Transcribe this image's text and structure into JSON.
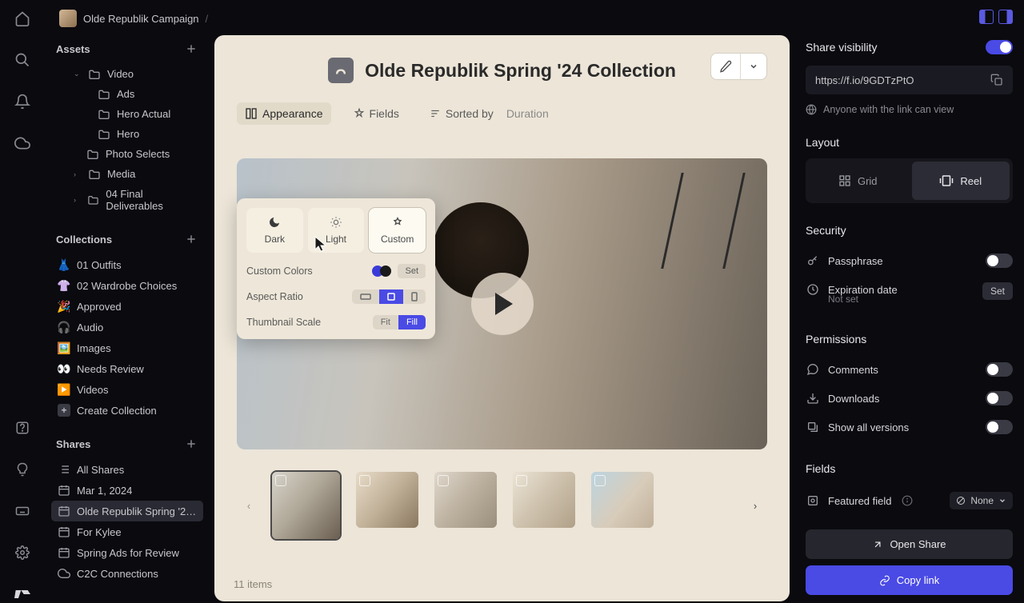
{
  "breadcrumb": {
    "project": "Olde Republik Campaign",
    "page": "Olde Republik Spring '24 …"
  },
  "assets": {
    "label": "Assets",
    "tree": [
      {
        "label": "Video",
        "indent": 1,
        "chev": true,
        "open": true
      },
      {
        "label": "Ads",
        "indent": 3
      },
      {
        "label": "Hero Actual",
        "indent": 3
      },
      {
        "label": "Hero",
        "indent": 3
      },
      {
        "label": "Photo Selects",
        "indent": 2
      },
      {
        "label": "Media",
        "indent": 1,
        "chev": true
      },
      {
        "label": "04 Final Deliverables",
        "indent": 1,
        "chev": true
      }
    ]
  },
  "collections": {
    "label": "Collections",
    "items": [
      {
        "icon": "👗",
        "label": "01 Outfits"
      },
      {
        "icon": "👚",
        "label": "02 Wardrobe Choices"
      },
      {
        "icon": "🎉",
        "label": "Approved"
      },
      {
        "icon": "🎧",
        "label": "Audio"
      },
      {
        "icon": "🖼️",
        "label": "Images"
      },
      {
        "icon": "👀",
        "label": "Needs Review"
      },
      {
        "icon": "▶️",
        "label": "Videos"
      }
    ],
    "create": "Create Collection"
  },
  "shares": {
    "label": "Shares",
    "items": [
      {
        "icon": "list",
        "label": "All Shares"
      },
      {
        "icon": "cal",
        "label": "Mar 1, 2024"
      },
      {
        "icon": "cal",
        "label": "Olde Republik Spring '24…",
        "active": true
      },
      {
        "icon": "cal",
        "label": "For Kylee"
      },
      {
        "icon": "cal",
        "label": "Spring Ads for Review"
      },
      {
        "icon": "cloud",
        "label": "C2C Connections"
      }
    ]
  },
  "page_title": "Olde Republik Spring '24 Collection",
  "toolbar": {
    "appearance": "Appearance",
    "fields": "Fields",
    "sorted_by": "Sorted by",
    "sorted_val": "Duration"
  },
  "popover": {
    "themes": {
      "dark": "Dark",
      "light": "Light",
      "custom": "Custom"
    },
    "custom_colors": {
      "label": "Custom Colors",
      "swatches": [
        "#3a3ad8",
        "#1a1a1a"
      ],
      "set": "Set"
    },
    "aspect_ratio": {
      "label": "Aspect Ratio"
    },
    "thumbnail_scale": {
      "label": "Thumbnail Scale",
      "fit": "Fit",
      "fill": "Fill"
    }
  },
  "item_count": "11 items",
  "right": {
    "share_visibility": "Share visibility",
    "url": "https://f.io/9GDTzPtO",
    "anyone": "Anyone with the link can view",
    "layout": {
      "label": "Layout",
      "grid": "Grid",
      "reel": "Reel"
    },
    "security": {
      "label": "Security",
      "passphrase": "Passphrase",
      "expiration": "Expiration date",
      "expiration_sub": "Not set",
      "set": "Set"
    },
    "permissions": {
      "label": "Permissions",
      "comments": "Comments",
      "downloads": "Downloads",
      "show_all": "Show all versions"
    },
    "fields": {
      "label": "Fields",
      "featured": "Featured field",
      "none": "None"
    },
    "open_share": "Open Share",
    "copy_link": "Copy link"
  }
}
